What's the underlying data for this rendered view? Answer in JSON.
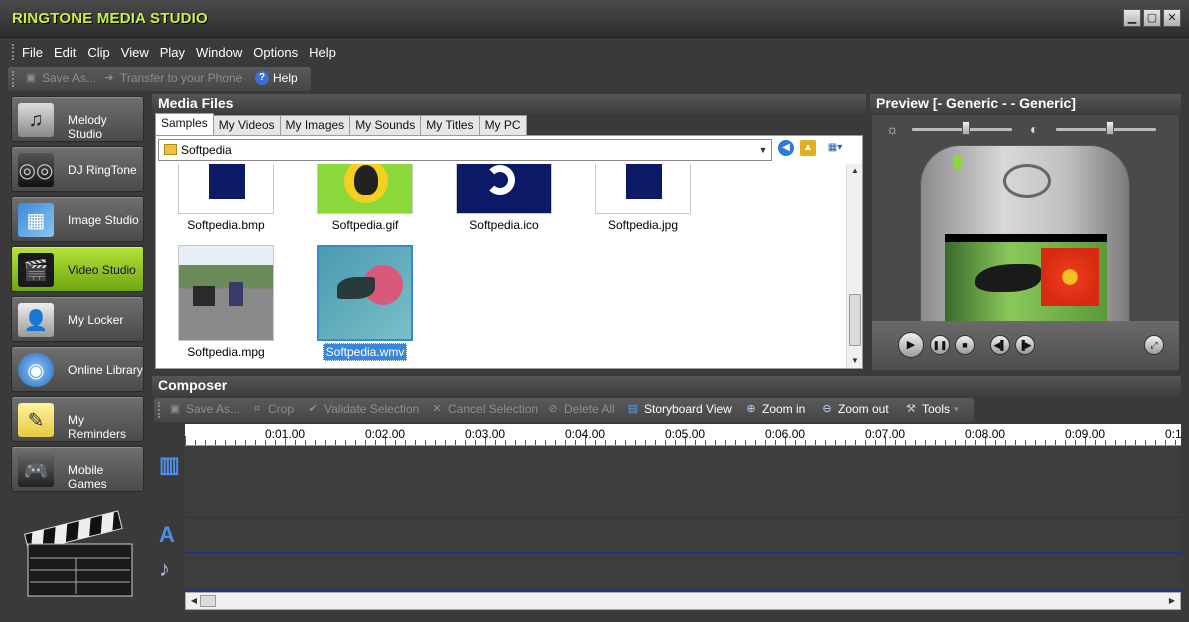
{
  "app": {
    "title": "RINGTONE MEDIA STUDIO"
  },
  "window_controls": {
    "minimize": "▁",
    "maximize": "▢",
    "close": "✕"
  },
  "menu": [
    "File",
    "Edit",
    "Clip",
    "View",
    "Play",
    "Window",
    "Options",
    "Help"
  ],
  "top_toolbar": {
    "save_as": "Save As...",
    "transfer": "Transfer to your Phone",
    "help": "Help"
  },
  "sidebar": {
    "items": [
      {
        "label": "Melody Studio",
        "icon": "melody-icon",
        "active": false
      },
      {
        "label": "DJ RingTone",
        "icon": "dj-icon",
        "active": false
      },
      {
        "label": "Image Studio",
        "icon": "image-icon",
        "active": false
      },
      {
        "label": "Video Studio",
        "icon": "video-icon",
        "active": true
      },
      {
        "label": "My Locker",
        "icon": "locker-icon",
        "active": false
      },
      {
        "label": "Online Library",
        "icon": "globe-icon",
        "active": false
      },
      {
        "label": "My Reminders",
        "icon": "reminder-icon",
        "active": false
      },
      {
        "label": "Mobile Games",
        "icon": "gamepad-icon",
        "active": false
      }
    ]
  },
  "media_files": {
    "title": "Media Files",
    "tabs": [
      "Samples",
      "My Videos",
      "My Images",
      "My Sounds",
      "My Titles",
      "My PC"
    ],
    "active_tab": "Samples",
    "path": "Softpedia",
    "files": [
      {
        "name": "Softpedia.bmp"
      },
      {
        "name": "Softpedia.gif"
      },
      {
        "name": "Softpedia.ico"
      },
      {
        "name": "Softpedia.jpg"
      },
      {
        "name": "Softpedia.mpg"
      },
      {
        "name": "Softpedia.wmv",
        "selected": true
      }
    ]
  },
  "preview": {
    "title": "Preview [- Generic - - Generic]"
  },
  "composer": {
    "title": "Composer",
    "toolbar": {
      "save_as": "Save As...",
      "crop": "Crop",
      "validate": "Validate Selection",
      "cancel": "Cancel Selection",
      "delete_all": "Delete All",
      "storyboard": "Storyboard View",
      "zoom_in": "Zoom in",
      "zoom_out": "Zoom out",
      "tools": "Tools"
    },
    "ruler_labels": [
      "0:01.00",
      "0:02.00",
      "0:03.00",
      "0:04.00",
      "0:05.00",
      "0:06.00",
      "0:07.00",
      "0:08.00",
      "0:09.00",
      "0:1"
    ]
  },
  "colors": {
    "accent": "#b6e33a",
    "title": "#c9f04a",
    "selection": "#3a86d8",
    "track_line": "#1e2c8a"
  }
}
